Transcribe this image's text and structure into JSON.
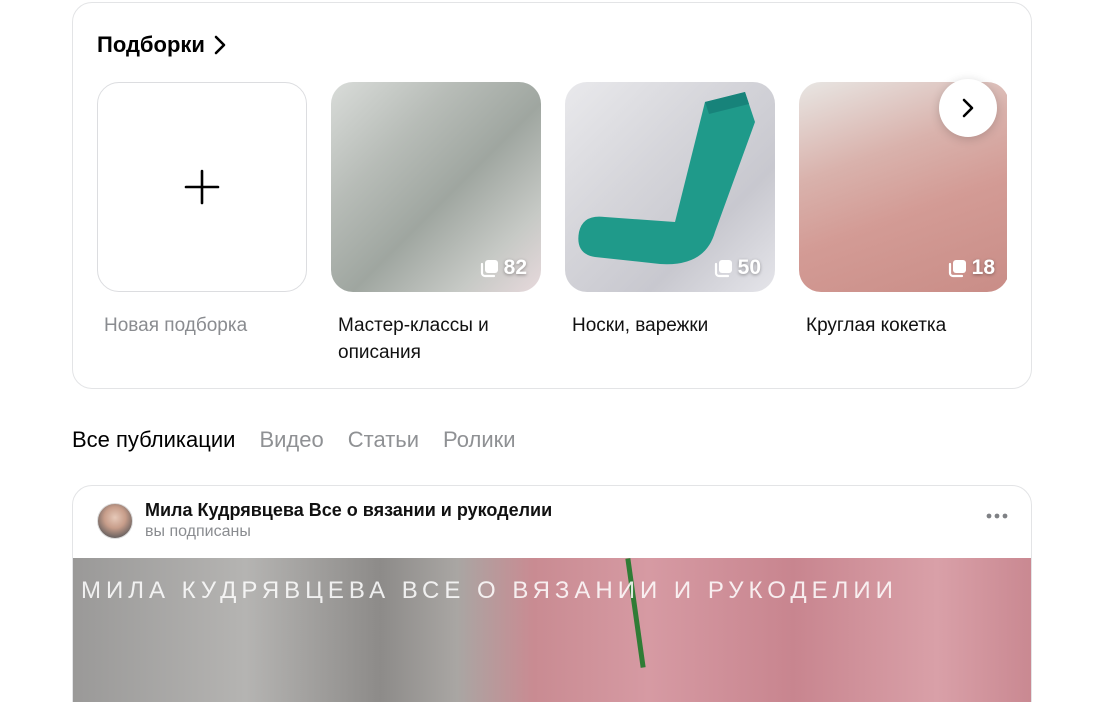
{
  "collections": {
    "title": "Подборки",
    "new_collection_label": "Новая подборка",
    "items": [
      {
        "label": "Мастер-классы и описания",
        "count": "82"
      },
      {
        "label": "Носки, варежки",
        "count": "50"
      },
      {
        "label": "Круглая кокетка",
        "count": "18"
      }
    ]
  },
  "tabs": [
    {
      "label": "Все публикации",
      "active": true
    },
    {
      "label": "Видео",
      "active": false
    },
    {
      "label": "Статьи",
      "active": false
    },
    {
      "label": "Ролики",
      "active": false
    }
  ],
  "post": {
    "author": "Мила Кудрявцева Все о вязании и рукоделии",
    "subscription_status": "вы подписаны",
    "watermark": "МИЛА КУДРЯВЦЕВА ВСЕ О ВЯЗАНИИ И РУКОДЕЛИИ"
  },
  "icons": {
    "add": "plus-icon",
    "header_chevron": "chevron-right-icon",
    "count": "stack-icon",
    "next": "chevron-right-icon",
    "more": "more-dots-icon"
  },
  "colors": {
    "active_text": "#000000",
    "muted_text": "#8f9194",
    "border": "#e3e4e6"
  }
}
